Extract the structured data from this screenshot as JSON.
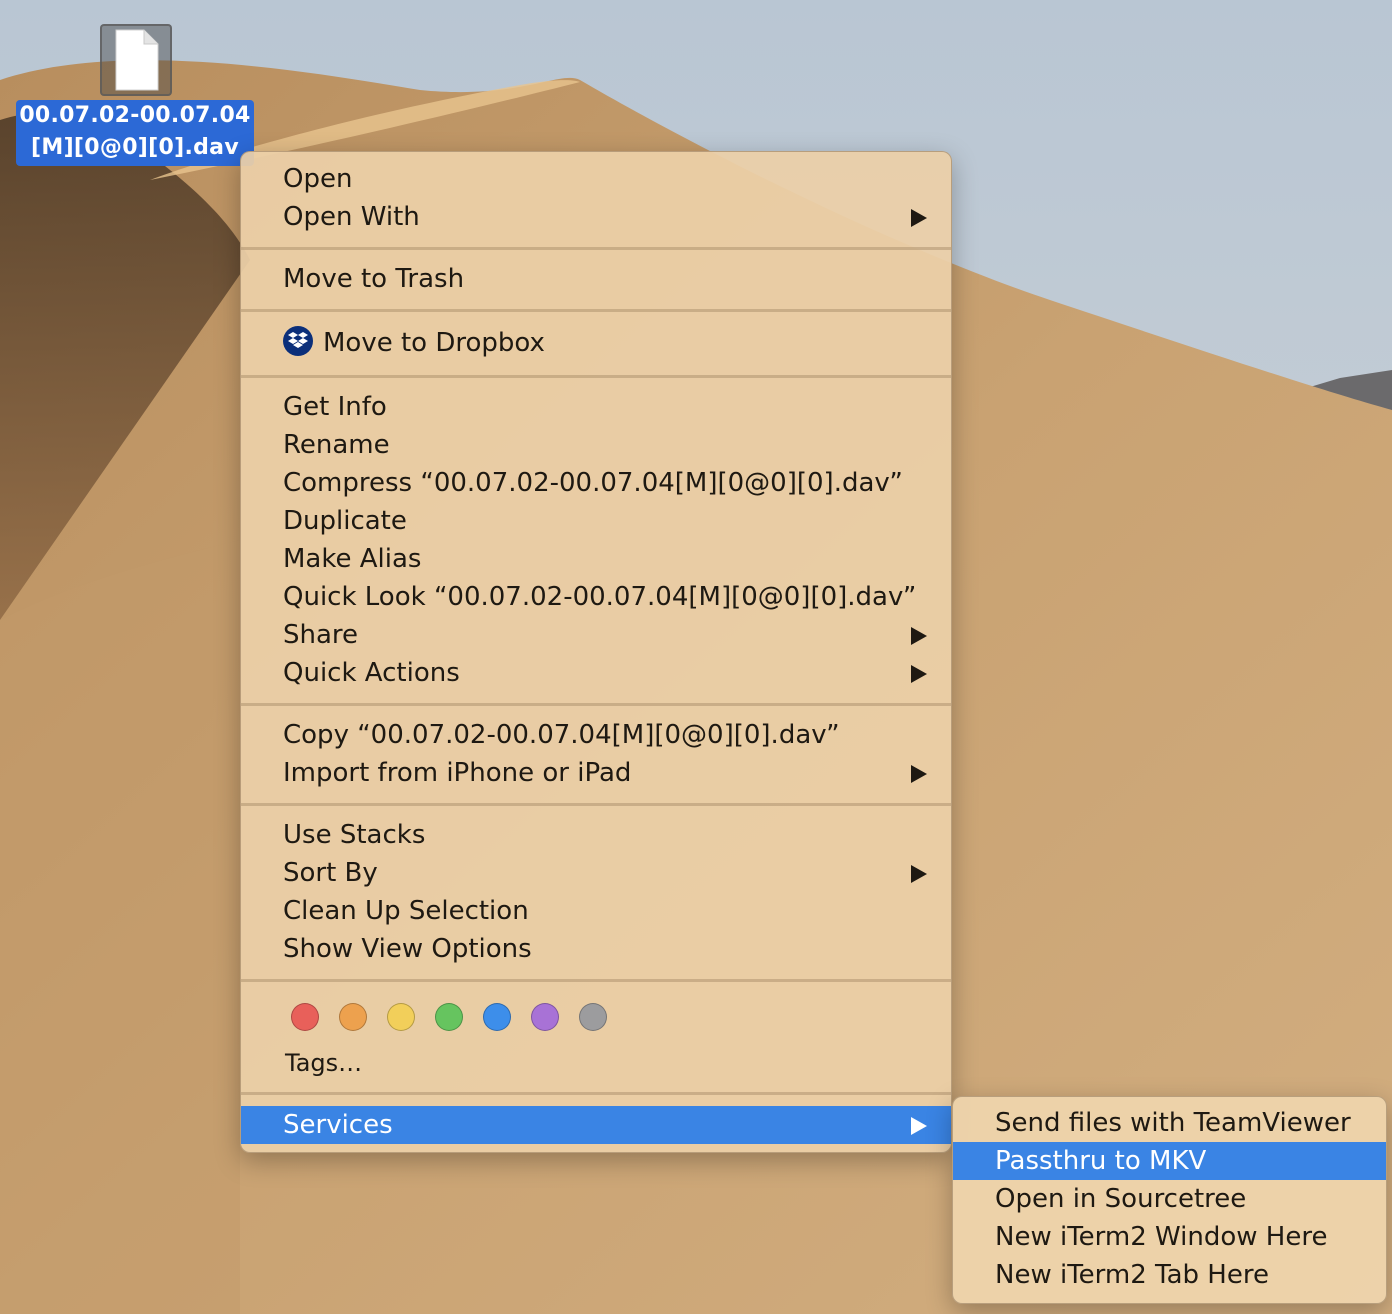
{
  "desktop": {
    "file": {
      "icon": "document-icon",
      "label_line1": "00.07.02-00.07.04",
      "label_line2": "[M][0@0][0].dav"
    }
  },
  "context_menu": {
    "open": "Open",
    "open_with": "Open With",
    "move_to_trash": "Move to Trash",
    "move_to_dropbox": "Move to Dropbox",
    "get_info": "Get Info",
    "rename": "Rename",
    "compress": "Compress “00.07.02-00.07.04[M][0@0][0].dav”",
    "duplicate": "Duplicate",
    "make_alias": "Make Alias",
    "quick_look": "Quick Look “00.07.02-00.07.04[M][0@0][0].dav”",
    "share": "Share",
    "quick_actions": "Quick Actions",
    "copy": "Copy “00.07.02-00.07.04[M][0@0][0].dav”",
    "import_from_iphone": "Import from iPhone or iPad",
    "use_stacks": "Use Stacks",
    "sort_by": "Sort By",
    "clean_up_selection": "Clean Up Selection",
    "show_view_options": "Show View Options",
    "tags_label": "Tags…",
    "tag_colors": [
      {
        "name": "red",
        "hex": "#e8605a"
      },
      {
        "name": "orange",
        "hex": "#eda14e"
      },
      {
        "name": "yellow",
        "hex": "#f2cf5a"
      },
      {
        "name": "green",
        "hex": "#66c45f"
      },
      {
        "name": "blue",
        "hex": "#3d8eea"
      },
      {
        "name": "purple",
        "hex": "#a872d6"
      },
      {
        "name": "gray",
        "hex": "#9c9c9e"
      }
    ],
    "services": "Services"
  },
  "services_submenu": {
    "items": [
      "Send files with TeamViewer",
      "Passthru to MKV",
      "Open in Sourcetree",
      "New iTerm2 Window Here",
      "New iTerm2 Tab Here"
    ],
    "highlighted": "Passthru to MKV"
  },
  "colors": {
    "highlight": "#3a84e4",
    "selection_label": "#2c69d6"
  }
}
